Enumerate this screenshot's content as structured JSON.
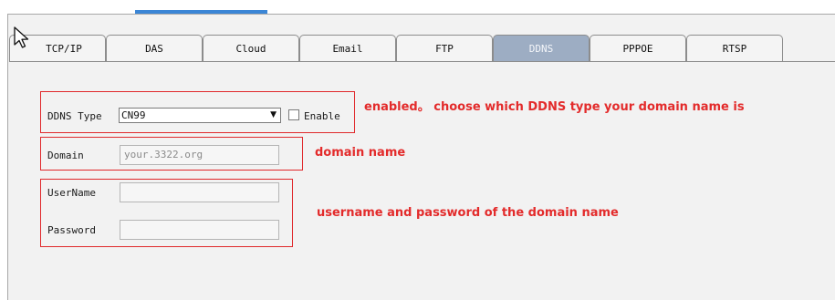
{
  "tabs": [
    {
      "label": "TCP/IP",
      "active": false
    },
    {
      "label": "DAS",
      "active": false
    },
    {
      "label": "Cloud",
      "active": false
    },
    {
      "label": "Email",
      "active": false
    },
    {
      "label": "FTP",
      "active": false
    },
    {
      "label": "DDNS",
      "active": true
    },
    {
      "label": "PPPOE",
      "active": false
    },
    {
      "label": "RTSP",
      "active": false
    }
  ],
  "form": {
    "ddns_type_label": "DDNS Type",
    "ddns_type_value": "CN99",
    "enable_label": "Enable",
    "enable_checked": false,
    "domain_label": "Domain",
    "domain_placeholder": "your.3322.org",
    "username_label": "UserName",
    "username_value": "",
    "password_label": "Password",
    "password_value": ""
  },
  "annotations": {
    "ddns_type": "enabled。 choose which DDNS type your domain name is",
    "domain": "domain name",
    "credentials": "username and password of  the domain name"
  },
  "colors": {
    "active_tab": "#9dadc3",
    "annotation_red": "#e32b2b",
    "top_accent": "#3b86d6"
  },
  "icons": {
    "cursor": "mouse-pointer-icon",
    "dropdown": "chevron-down-icon"
  }
}
